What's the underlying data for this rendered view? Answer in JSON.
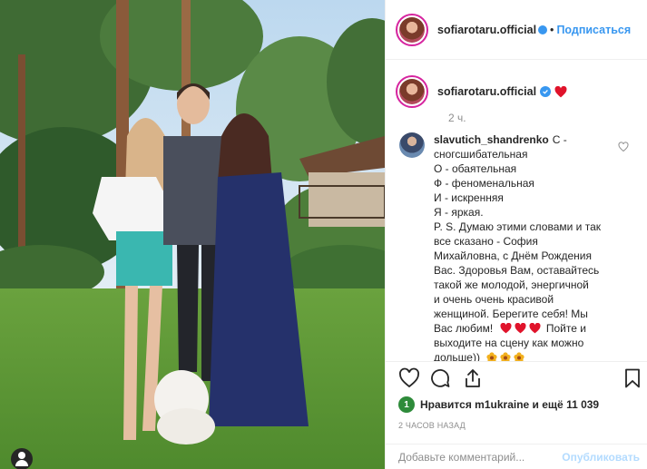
{
  "post": {
    "username": "sofiarotaru.official",
    "follow_separator": "•",
    "follow_label": "Подписаться",
    "caption_time": "2 ч.",
    "icons": {
      "verified": "verified-badge-icon",
      "caption_emoji": "red-heart-emoji"
    }
  },
  "comment": {
    "username": "slavutich_shandrenko",
    "lines": [
      "С -",
      "сногсшибательная",
      "О - обаятельная",
      "Ф - феноменальная",
      "И - искренняя",
      "Я - яркая.",
      "P. S. Думаю этими словами и так",
      "все сказано - София",
      "Михайловна, с Днём Рождения",
      "Вас. Здоровья Вам, оставайтесь",
      "такой же молодой, энергичной",
      "и очень очень красивой",
      "женщиной. Берегите себя! Мы",
      "Вас любим!",
      "Пойте и",
      "выходите на сцену как можно",
      "дольше))"
    ]
  },
  "likes": {
    "prefix": "Нравится",
    "user": "m1ukraine",
    "suffix": "и ещё 11 039"
  },
  "timestamp": "2 ЧАСОВ НАЗАД",
  "add_comment": {
    "placeholder": "Добавьте комментарий...",
    "publish_label": "Опубликовать"
  },
  "colors": {
    "accent": "#3897f0",
    "text": "#262626",
    "muted": "#8e8e8e",
    "publish_disabled": "#b3dbff"
  }
}
